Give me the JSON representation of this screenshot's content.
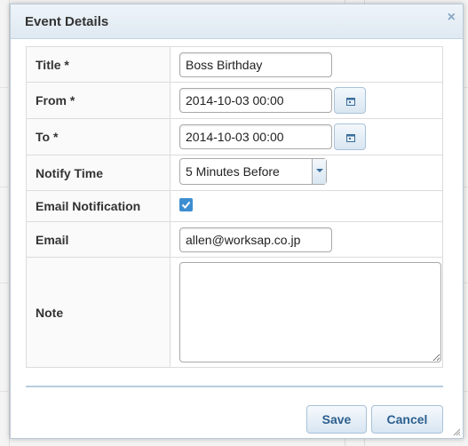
{
  "dialog": {
    "title": "Event Details",
    "close_label": "×"
  },
  "form": {
    "title_label": "Title",
    "title_value": "Boss Birthday",
    "from_label": "From",
    "from_value": "2014-10-03 00:00",
    "to_label": "To",
    "to_value": "2014-10-03 00:00",
    "notify_label": "Notify Time",
    "notify_value": "5 Minutes Before",
    "email_notif_label": "Email Notification",
    "email_notif_checked": true,
    "email_label": "Email",
    "email_value": "allen@worksap.co.jp",
    "note_label": "Note",
    "note_value": "",
    "required_mark": "*"
  },
  "buttons": {
    "save_label": "Save",
    "cancel_label": "Cancel"
  },
  "icons": {
    "calendar": "calendar-icon",
    "close": "close-icon",
    "check": "check-icon",
    "dropdown": "chevron-down-icon"
  },
  "colors": {
    "accent": "#3d8ed0",
    "button_text": "#2c5f8e",
    "header_bg": "#dfe9f2"
  }
}
